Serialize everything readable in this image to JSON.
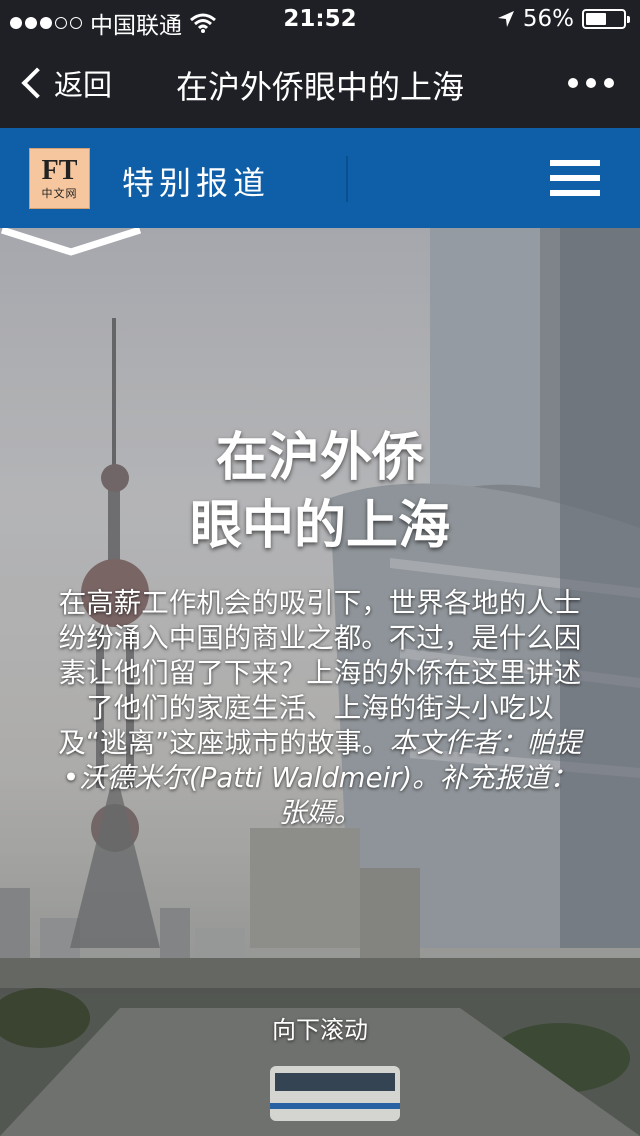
{
  "status_bar": {
    "carrier": "中国联通",
    "time": "21:52",
    "battery_text": "56%",
    "battery_level": 0.56
  },
  "nav": {
    "back_label": "返回",
    "title": "在沪外侨眼中的上海"
  },
  "header": {
    "logo_main": "FT",
    "logo_sub": "中文网",
    "section_title": "特别报道",
    "brand_color": "#0e5fa8"
  },
  "article": {
    "headline_line1": "在沪外侨",
    "headline_line2": "眼中的上海",
    "deck": "在高薪工作机会的吸引下，世界各地的人士纷纷涌入中国的商业之都。不过，是什么因素让他们留了下来？上海的外侨在这里讲述了他们的家庭生活、上海的街头小吃以及“逃离”这座城市的故事。",
    "byline": "本文作者：帕提•沃德米尔(Patti Waldmeir)。补充报道：张嫣。"
  },
  "scroll_hint": {
    "label": "向下滚动",
    "icon": "chevron-down-icon"
  }
}
